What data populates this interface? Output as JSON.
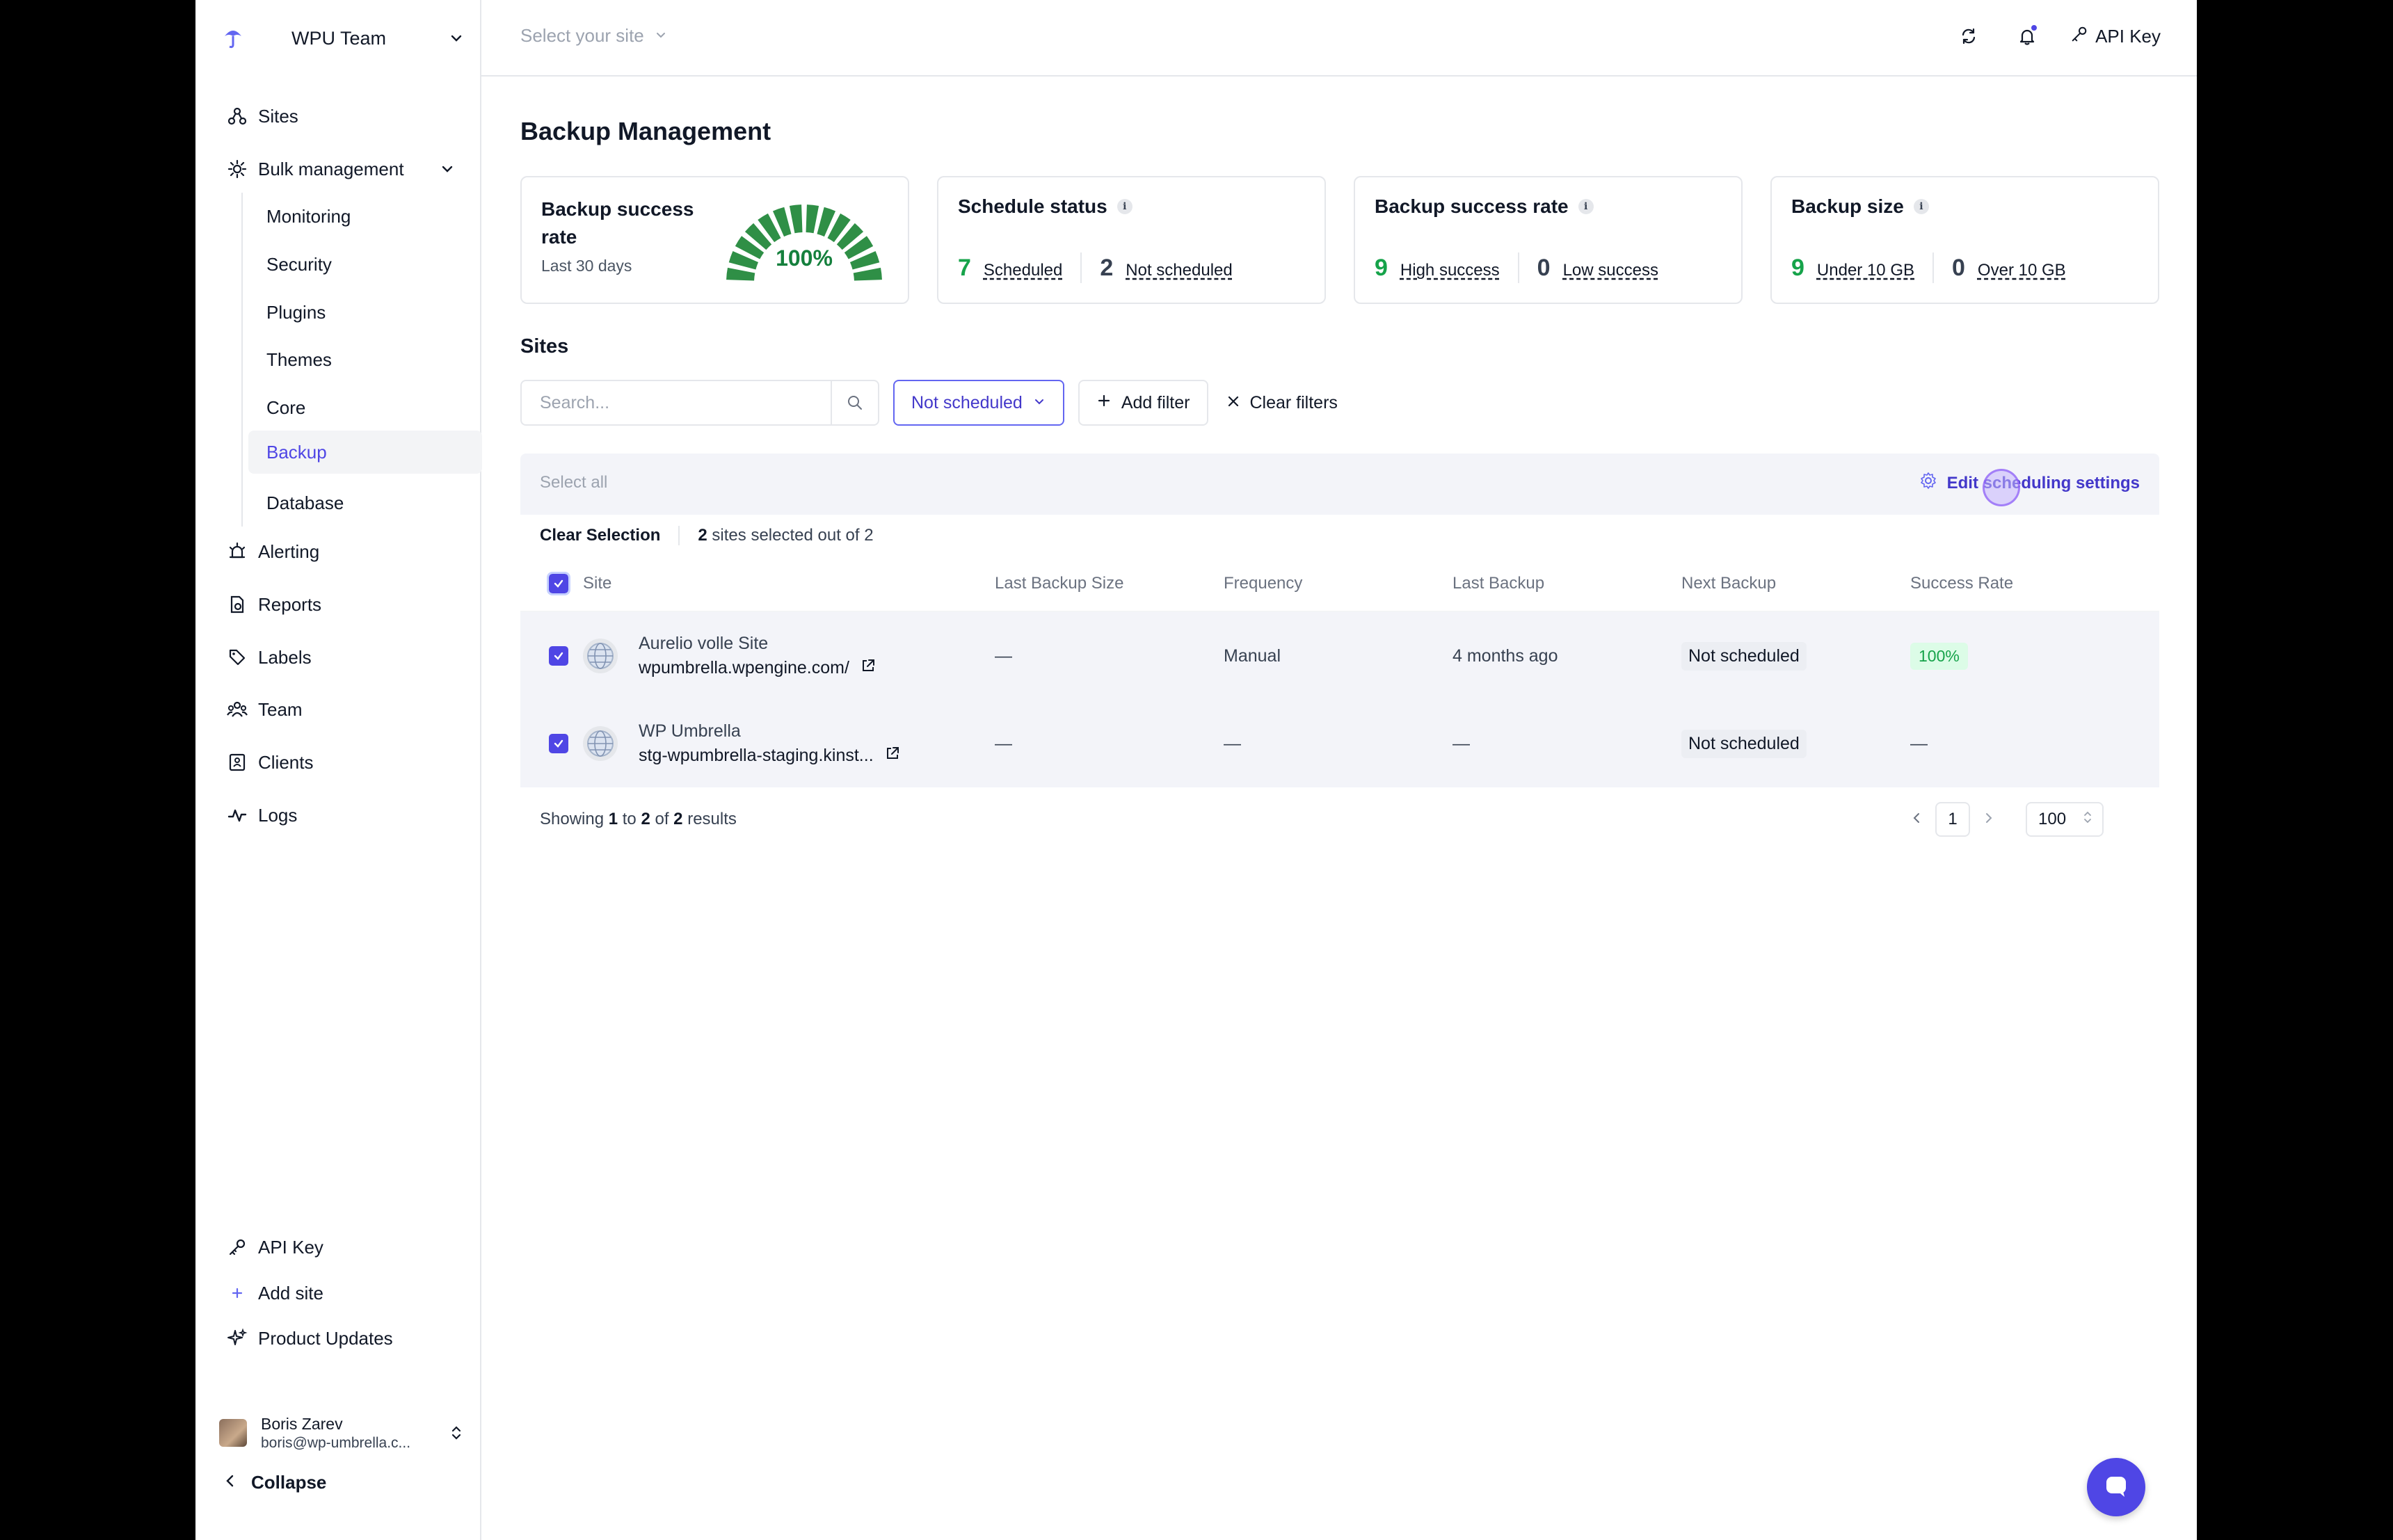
{
  "team": {
    "name": "WPU Team"
  },
  "sidebar": {
    "items": [
      {
        "label": "Sites",
        "icon": "sites-icon"
      },
      {
        "label": "Bulk management",
        "icon": "bulk-management-icon"
      },
      {
        "label": "Alerting",
        "icon": "alerting-icon"
      },
      {
        "label": "Reports",
        "icon": "reports-icon"
      },
      {
        "label": "Labels",
        "icon": "tag-icon"
      },
      {
        "label": "Team",
        "icon": "team-icon"
      },
      {
        "label": "Clients",
        "icon": "clients-icon"
      },
      {
        "label": "Logs",
        "icon": "logs-icon"
      }
    ],
    "sub_items": [
      "Monitoring",
      "Security",
      "Plugins",
      "Themes",
      "Core",
      "Backup",
      "Database"
    ],
    "active_sub": "Backup",
    "bottom": [
      {
        "label": "API Key",
        "icon": "key-icon"
      },
      {
        "label": "Add site",
        "icon": "plus-icon"
      },
      {
        "label": "Product Updates",
        "icon": "sparkle-icon"
      }
    ],
    "user": {
      "name": "Boris Zarev",
      "email": "boris@wp-umbrella.c..."
    },
    "collapse_label": "Collapse"
  },
  "topbar": {
    "site_select_placeholder": "Select your site",
    "api_key_label": "API Key"
  },
  "page": {
    "title": "Backup Management"
  },
  "cards": {
    "success_rate": {
      "title": "Backup success rate",
      "subtitle": "Last 30 days",
      "value": "100%",
      "fraction": 1.0
    },
    "schedule_status": {
      "title": "Schedule status",
      "stats": [
        {
          "num": "7",
          "label": "Scheduled",
          "color": "green"
        },
        {
          "num": "2",
          "label": "Not scheduled",
          "color": "dark"
        }
      ]
    },
    "success_rate_breakdown": {
      "title": "Backup success rate",
      "stats": [
        {
          "num": "9",
          "label": "High success",
          "color": "green"
        },
        {
          "num": "0",
          "label": "Low success",
          "color": "dark"
        }
      ]
    },
    "backup_size": {
      "title": "Backup size",
      "stats": [
        {
          "num": "9",
          "label": "Under 10 GB",
          "color": "green"
        },
        {
          "num": "0",
          "label": "Over 10 GB",
          "color": "dark"
        }
      ]
    }
  },
  "sites_section": {
    "title": "Sites",
    "search_placeholder": "Search...",
    "active_filter": "Not scheduled",
    "add_filter_label": "Add filter",
    "clear_filters_label": "Clear filters",
    "select_all_label": "Select all",
    "edit_scheduling_label": "Edit scheduling settings",
    "clear_selection_label": "Clear Selection",
    "selected_count": "2",
    "selected_suffix": " sites selected out of 2"
  },
  "table": {
    "headers": [
      "Site",
      "Last Backup Size",
      "Frequency",
      "Last Backup",
      "Next Backup",
      "Success Rate"
    ],
    "rows": [
      {
        "name": "Aurelio volle Site",
        "url": "wpumbrella.wpengine.com/",
        "size": "—",
        "frequency": "Manual",
        "last_backup": "4 months ago",
        "next_backup": "Not scheduled",
        "success_rate": "100%"
      },
      {
        "name": "WP Umbrella",
        "url": "stg-wpumbrella-staging.kinst...",
        "size": "—",
        "frequency": "—",
        "last_backup": "—",
        "next_backup": "Not scheduled",
        "success_rate": "—"
      }
    ]
  },
  "pagination": {
    "showing_prefix": "Showing ",
    "from": "1",
    "to_word": " to ",
    "to": "2",
    "of_word": " of ",
    "total": "2",
    "suffix": " results",
    "current_page": "1",
    "per_page": "100"
  },
  "colors": {
    "accent": "#4f46e5",
    "success": "#16a34a",
    "gauge": "#2f8f46"
  }
}
